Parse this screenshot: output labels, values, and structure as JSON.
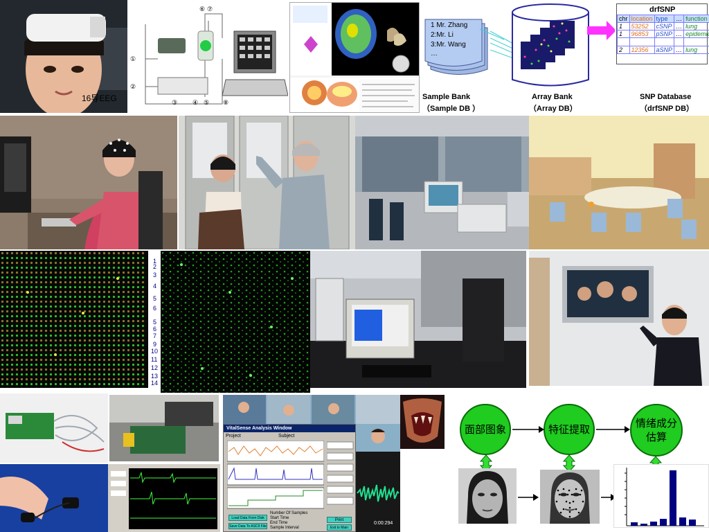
{
  "photo_caption": "16导EEG",
  "sample_bank": {
    "rows": [
      "1 Mr. Zhang",
      "2:Mr. Li",
      "3:Mr. Wang",
      "…"
    ],
    "label_line1": "Sample Bank",
    "label_line2": "（Sample DB ）"
  },
  "array_bank": {
    "label_line1": "Array Bank",
    "label_line2": "（Array DB）"
  },
  "snp_db": {
    "title": "drfSNP",
    "headers": [
      "chr",
      "location",
      "type",
      "…",
      "function"
    ],
    "rows": [
      [
        "1",
        "53252",
        "cSNP",
        "…",
        "lung"
      ],
      [
        "1",
        "96853",
        "pSNP",
        "…",
        "epidemic"
      ],
      [
        "",
        "",
        "",
        "",
        ""
      ],
      [
        "2",
        "12356",
        "aSNP",
        "…",
        "lung"
      ]
    ],
    "label_line1": "SNP Database",
    "label_line2": "（drfSNP DB）"
  },
  "diagram_left": {
    "labels": [
      "⑥",
      "⑦",
      "①",
      "②",
      "③",
      "④",
      "⑤",
      "⑧"
    ]
  },
  "array_numbers": [
    "1",
    "2",
    "3",
    "4",
    "5",
    "6",
    "5",
    "6",
    "7",
    "9",
    "10",
    "11",
    "12",
    "13",
    "14"
  ],
  "flow": {
    "step1": "面部图象",
    "step2": "特征提取",
    "step3": "情绪成分估算"
  },
  "software": {
    "title": "VitalSense Analysis Window",
    "project_label": "Project",
    "subject_label": "Subject",
    "time_readout": "0:00:294",
    "buttons": [
      "Load Data From Disk",
      "Save Data To ASCII File",
      "Print",
      "Exit to Main"
    ],
    "info": [
      "Number Of Samples",
      "Start Time",
      "End Time",
      "Sample Interval"
    ]
  },
  "colors": {
    "accent_green": "#1fcc1f",
    "arrow_magenta": "#ff33ff",
    "db_blue": "#2a2aa0"
  }
}
